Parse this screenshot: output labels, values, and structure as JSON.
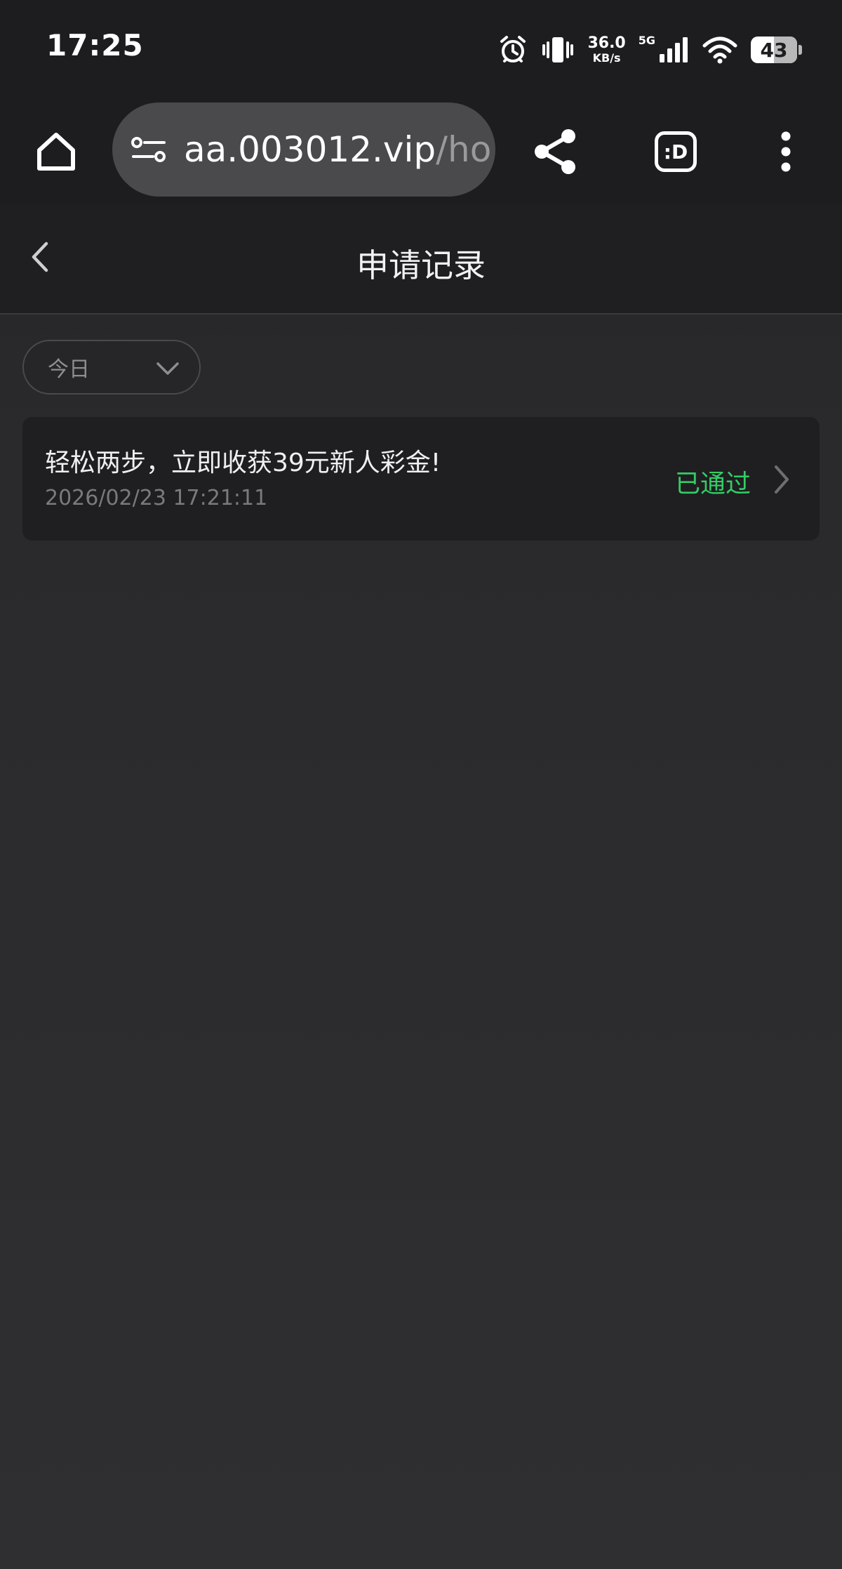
{
  "status_bar": {
    "time": "17:25",
    "net_speed_value": "36.0",
    "net_speed_unit": "KB/s",
    "network_type": "5G",
    "battery_level": "43",
    "icons": [
      "alarm-icon",
      "vibrate-icon",
      "signal-icon",
      "wifi-icon",
      "battery-icon"
    ]
  },
  "browser": {
    "url_host": "aa.003012.vip",
    "url_path": "/ho",
    "tab_button_label": ":D",
    "icons": [
      "home-icon",
      "site-settings-icon",
      "share-icon",
      "tab-switcher-icon",
      "more-menu-icon"
    ]
  },
  "header": {
    "title": "申请记录"
  },
  "filter": {
    "selected": "今日"
  },
  "records": [
    {
      "title": "轻松两步，立即收获39元新人彩金!",
      "time": "2026/02/23 17:21:11",
      "status": "已通过"
    }
  ],
  "colors": {
    "status_approved": "#33cc66",
    "toolbar_bg": "#1d1d1f",
    "page_bg": "#2d2d2f"
  }
}
